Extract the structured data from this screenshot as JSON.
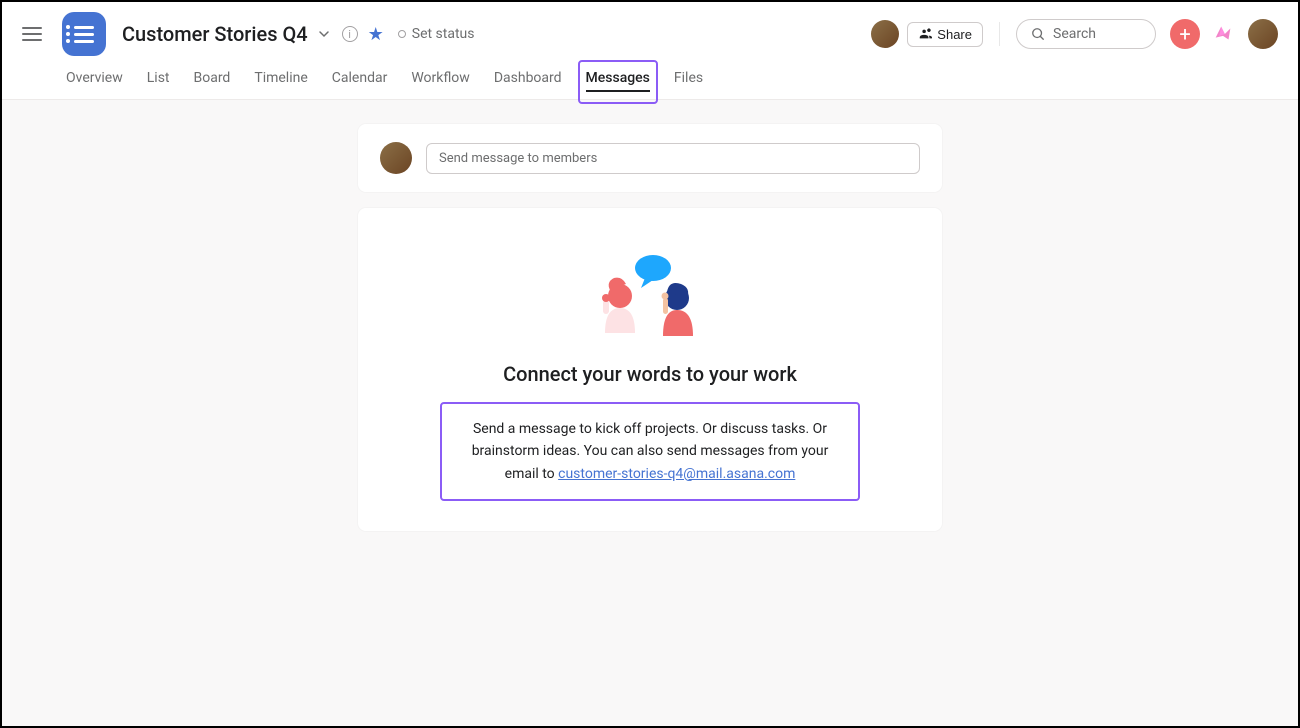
{
  "header": {
    "project_title": "Customer Stories Q4",
    "set_status_label": "Set status",
    "share_label": "Share",
    "search_placeholder": "Search"
  },
  "tabs": [
    {
      "label": "Overview",
      "active": false
    },
    {
      "label": "List",
      "active": false
    },
    {
      "label": "Board",
      "active": false
    },
    {
      "label": "Timeline",
      "active": false
    },
    {
      "label": "Calendar",
      "active": false
    },
    {
      "label": "Workflow",
      "active": false
    },
    {
      "label": "Dashboard",
      "active": false
    },
    {
      "label": "Messages",
      "active": true
    },
    {
      "label": "Files",
      "active": false
    }
  ],
  "compose": {
    "placeholder": "Send message to members"
  },
  "empty_state": {
    "title": "Connect your words to your work",
    "description_pre": "Send a message to kick off projects. Or discuss tasks. Or brainstorm ideas. You can also send messages from your email to ",
    "email_link": "customer-stories-q4@mail.asana.com"
  },
  "colors": {
    "accent_blue": "#4573d2",
    "highlight_purple": "#8b5cf6",
    "add_button": "#f06a6a"
  }
}
